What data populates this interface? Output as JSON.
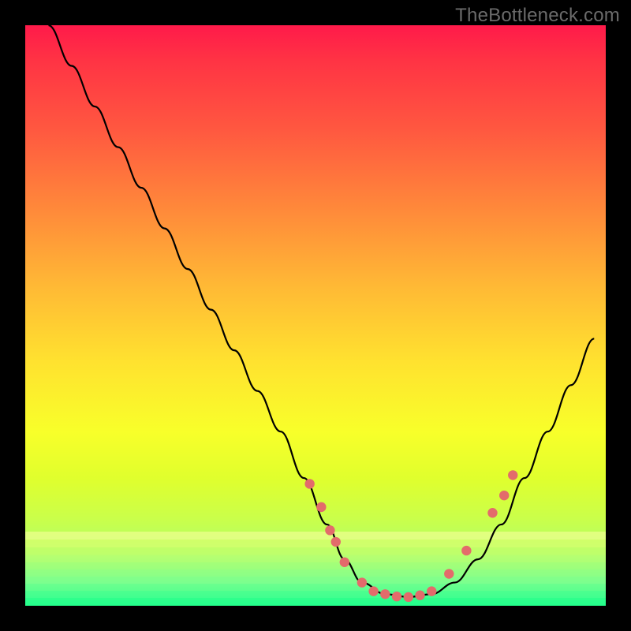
{
  "watermark": "TheBottleneck.com",
  "chart_data": {
    "type": "line",
    "title": "",
    "xlabel": "",
    "ylabel": "",
    "xlim": [
      0,
      100
    ],
    "ylim": [
      0,
      100
    ],
    "grid": false,
    "series": [
      {
        "name": "bottleneck-curve",
        "x": [
          4,
          8,
          12,
          16,
          20,
          24,
          28,
          32,
          36,
          40,
          44,
          48,
          52,
          55,
          58,
          62,
          66,
          70,
          74,
          78,
          82,
          86,
          90,
          94,
          98
        ],
        "y": [
          100,
          93,
          86,
          79,
          72,
          65,
          58,
          51,
          44,
          37,
          30,
          22,
          14,
          8,
          4,
          2,
          1.5,
          2,
          4,
          8,
          14,
          22,
          30,
          38,
          46
        ],
        "color": "#000000"
      }
    ],
    "markers": {
      "name": "highlight-points",
      "color": "#e36b6b",
      "points": [
        {
          "x": 49,
          "y": 21
        },
        {
          "x": 51,
          "y": 17
        },
        {
          "x": 52.5,
          "y": 13
        },
        {
          "x": 53.5,
          "y": 11
        },
        {
          "x": 55,
          "y": 7.5
        },
        {
          "x": 58,
          "y": 4
        },
        {
          "x": 60,
          "y": 2.5
        },
        {
          "x": 62,
          "y": 2
        },
        {
          "x": 64,
          "y": 1.6
        },
        {
          "x": 66,
          "y": 1.5
        },
        {
          "x": 68,
          "y": 1.8
        },
        {
          "x": 70,
          "y": 2.5
        },
        {
          "x": 73,
          "y": 5.5
        },
        {
          "x": 76,
          "y": 9.5
        },
        {
          "x": 80.5,
          "y": 16
        },
        {
          "x": 82.5,
          "y": 19
        },
        {
          "x": 84,
          "y": 22.5
        }
      ]
    }
  }
}
